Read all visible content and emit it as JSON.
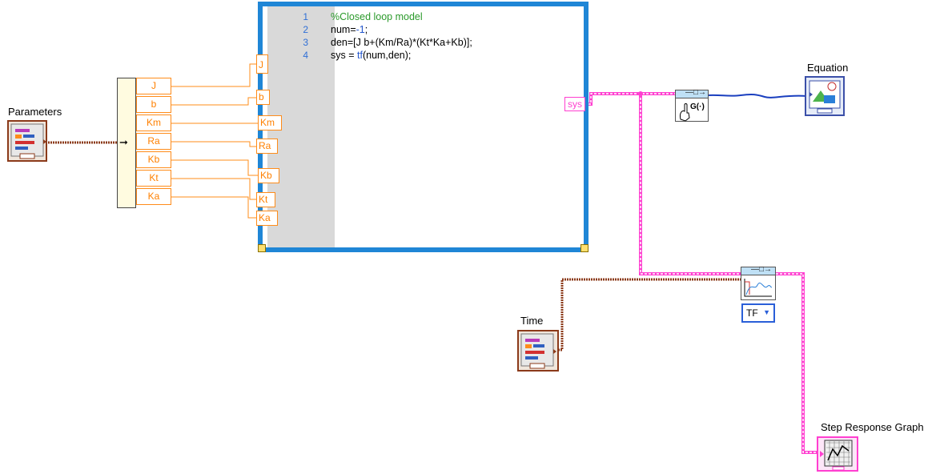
{
  "controls": {
    "parameters_label": "Parameters",
    "time_label": "Time"
  },
  "indicators": {
    "equation_label": "Equation",
    "step_graph_label": "Step Response Graph"
  },
  "unbundle": {
    "fields": [
      "J",
      "b",
      "Km",
      "Ra",
      "Kb",
      "Kt",
      "Ka"
    ]
  },
  "mathscript": {
    "inputs": [
      "J",
      "b",
      "Km",
      "Ra",
      "Kb",
      "Kt",
      "Ka"
    ],
    "output": "sys",
    "line_numbers": [
      "1",
      "2",
      "3",
      "4"
    ],
    "code": {
      "l1": "%Closed loop model",
      "l2_a": "num=",
      "l2_b": "-1",
      "l2_c": ";",
      "l3": "den=[J b+(Km/Ra)*(Kt*Ka+Kb)];",
      "l4_a": "sys = ",
      "l4_b": "tf",
      "l4_c": "(num,den);"
    }
  },
  "step_response": {
    "selector": "TF"
  },
  "colors": {
    "cluster_wire": "#8b3a1a",
    "numeric_wire": "#ff8c1a",
    "sys_wire": "#ff3fd0",
    "string_wire": "#1a3fbf",
    "structure_border": "#1f86d6",
    "gutter": "#d9d9d9",
    "code_comment": "#2b9a2b",
    "code_keyword": "#2255cc"
  }
}
